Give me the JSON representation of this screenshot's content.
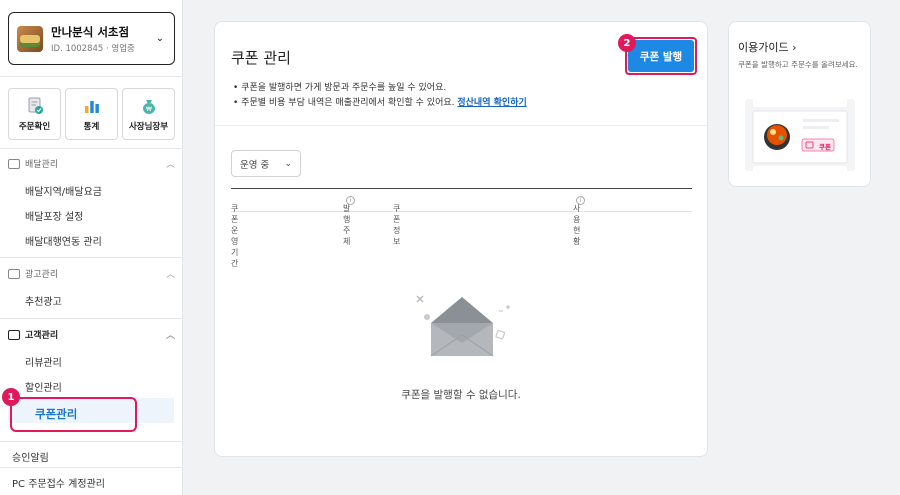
{
  "sidebar": {
    "store": {
      "name": "만나분식 서초점",
      "id_status": "ID. 1002845 · 영업중"
    },
    "quick": [
      {
        "label": "주문확인",
        "icon": "order-check-icon"
      },
      {
        "label": "통계",
        "icon": "bar-chart-icon"
      },
      {
        "label": "사장님장부",
        "icon": "money-bag-icon"
      }
    ],
    "sections": {
      "delivery": {
        "title": "배달관리",
        "items": [
          "배달지역/배달요금",
          "배달포장 설정",
          "배달대행연동 관리"
        ]
      },
      "ads": {
        "title": "광고관리",
        "items": [
          "추천광고"
        ]
      },
      "customer": {
        "title": "고객관리",
        "items": [
          "리뷰관리",
          "할인관리",
          "쿠폰관리"
        ]
      }
    },
    "extra": [
      "승인알림",
      "PC 주문접수 계정관리"
    ]
  },
  "badges": {
    "one": "1",
    "two": "2"
  },
  "main": {
    "title": "쿠폰 관리",
    "issue_button": "쿠폰 발행",
    "note1": "쿠폰을 발행하면 가게 방문과 주문수를 높일 수 있어요.",
    "note2": "주문별 비용 부담 내역은 매출관리에서 확인할 수 있어요.",
    "note2_link": "정산내역 확인하기",
    "filter": "운영 중",
    "columns": [
      "쿠폰 운영기간",
      "발행주체",
      "쿠폰정보",
      "사용현황"
    ],
    "empty": "쿠폰을 발행할 수 없습니다."
  },
  "guide": {
    "title": "이용가이드",
    "desc": "쿠폰을 발행하고 주문수를 올려보세요.",
    "tag": "쿠폰"
  },
  "colors": {
    "accent": "#1e88e5",
    "highlight": "#e0195a"
  }
}
